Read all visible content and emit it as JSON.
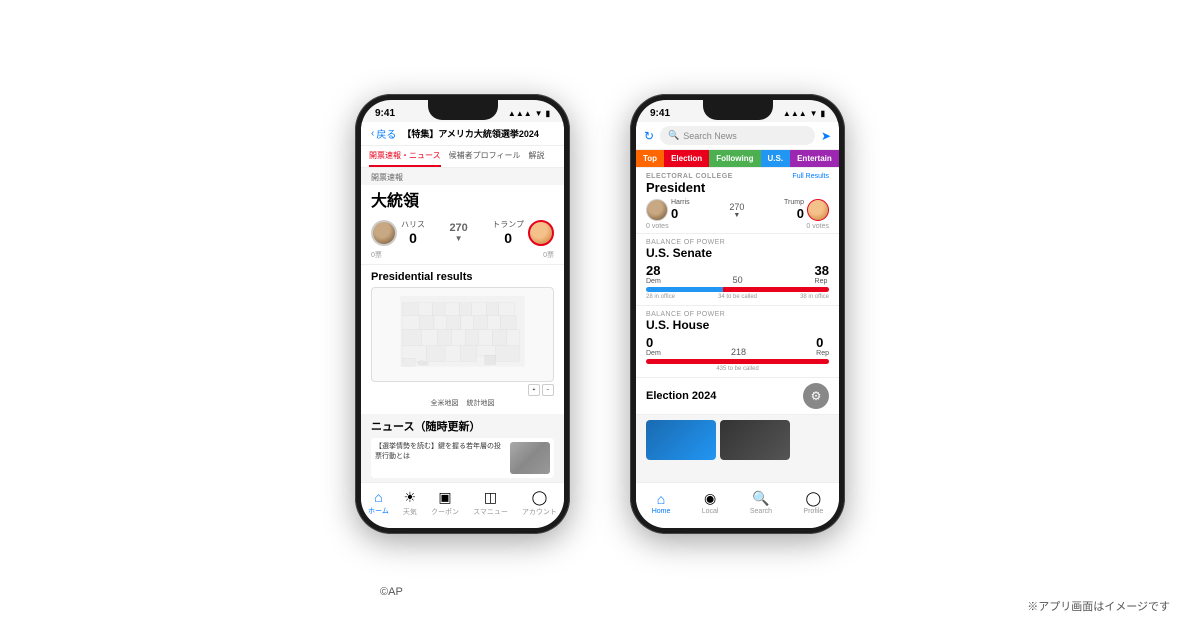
{
  "scene": {
    "bg": "#ffffff"
  },
  "footnote_ap": "©AP",
  "footnote_jp": "※アプリ画面はイメージです",
  "left_phone": {
    "status_time": "9:41",
    "back_label": "戻る",
    "nav_title": "【特集】アメリカ大統領選挙2024",
    "tabs": [
      "開票速報・ニュース",
      "候補者プロフィール",
      "解説"
    ],
    "section_label": "開票速報",
    "section_title": "大統領",
    "harris_name": "ハリス",
    "harris_votes": "0",
    "trump_name": "トランプ",
    "trump_votes": "0",
    "electoral_num": "270",
    "votes_left": "0票",
    "votes_right": "0票",
    "map_title": "Presidential results",
    "map_btn1": "全米地図",
    "map_btn2": "統計地図",
    "news_section_title": "ニュース（随時更新）",
    "news_item_text": "【選挙情勢を読む】鍵を握る若年層の投票行動とは",
    "bottom_nav": [
      "ホーム",
      "天気",
      "クーポン",
      "スマニュー",
      "アカウント"
    ]
  },
  "right_phone": {
    "status_time": "9:41",
    "search_placeholder": "Search News",
    "tabs": [
      "Top",
      "Election",
      "Following",
      "U.S.",
      "Entertain"
    ],
    "ec_label": "ELECTORAL COLLEGE",
    "ec_full": "Full Results",
    "ec_title": "President",
    "harris_name": "Harris",
    "harris_votes": "0",
    "trump_name": "Trump",
    "trump_votes": "0",
    "electoral_mid": "270",
    "votes_left": "0 votes",
    "votes_right": "0 votes",
    "senate_label": "BALANCE OF POWER",
    "senate_title": "U.S. Senate",
    "senate_dem": "28",
    "senate_dem_label": "Dem",
    "senate_mid": "50",
    "senate_rep": "38",
    "senate_rep_label": "Rep",
    "senate_sub_left": "28 in office",
    "senate_sub_mid": "34 to be called",
    "senate_sub_right": "38 in office",
    "house_label": "BALANCE OF POWER",
    "house_title": "U.S. House",
    "house_dem": "0",
    "house_dem_label": "Dem",
    "house_mid": "218",
    "house_rep": "0",
    "house_rep_label": "Rep",
    "house_sub_mid": "435 to be called",
    "election2024": "Election 2024",
    "bottom_nav": [
      "Home",
      "Local",
      "Search",
      "Profile"
    ]
  }
}
